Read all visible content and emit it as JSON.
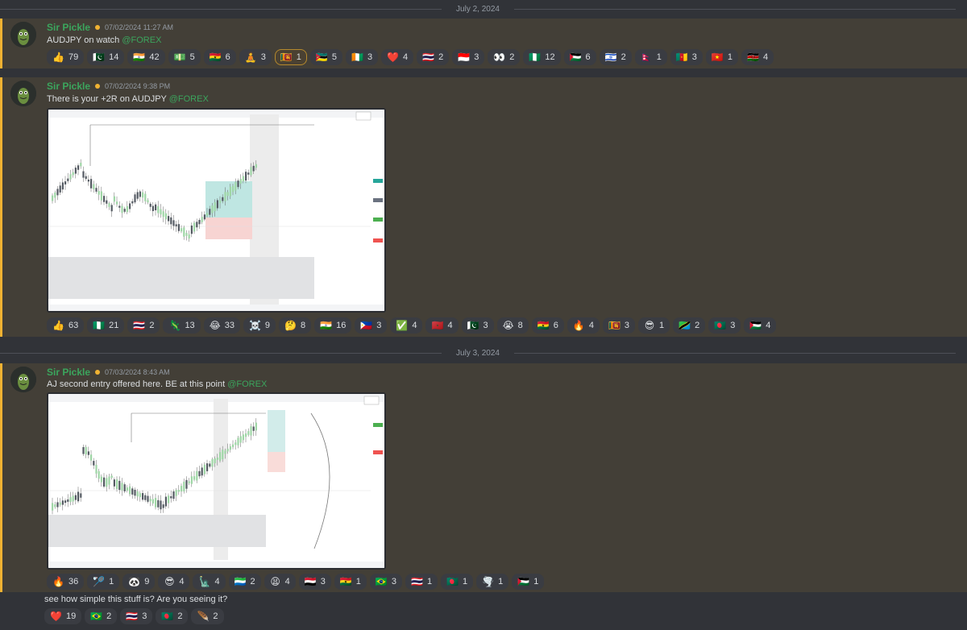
{
  "dividers": {
    "d1": "July 2, 2024",
    "d2": "July 3, 2024"
  },
  "messages": [
    {
      "author": "Sir Pickle",
      "timestamp": "07/02/2024 11:27 AM",
      "text": "AUDJPY on watch ",
      "mention": "@FOREX",
      "reactions": [
        {
          "emoji": "👍",
          "count": "79"
        },
        {
          "emoji": "🇵🇰",
          "count": "14"
        },
        {
          "emoji": "🇮🇳",
          "count": "42"
        },
        {
          "emoji": "💵",
          "count": "5"
        },
        {
          "emoji": "🇬🇭",
          "count": "6"
        },
        {
          "emoji": "🧘",
          "count": "3"
        },
        {
          "emoji": "🇱🇰",
          "count": "1",
          "active": true
        },
        {
          "emoji": "🇲🇿",
          "count": "5"
        },
        {
          "emoji": "🇨🇮",
          "count": "3"
        },
        {
          "emoji": "❤️",
          "count": "4"
        },
        {
          "emoji": "🇹🇭",
          "count": "2"
        },
        {
          "emoji": "🇮🇩",
          "count": "3"
        },
        {
          "emoji": "👀",
          "count": "2"
        },
        {
          "emoji": "🇳🇬",
          "count": "12"
        },
        {
          "emoji": "🇵🇸",
          "count": "6"
        },
        {
          "emoji": "🇮🇱",
          "count": "2"
        },
        {
          "emoji": "🇳🇵",
          "count": "1"
        },
        {
          "emoji": "🇨🇲",
          "count": "3"
        },
        {
          "emoji": "🇻🇳",
          "count": "1"
        },
        {
          "emoji": "🇰🇪",
          "count": "4"
        }
      ]
    },
    {
      "author": "Sir Pickle",
      "timestamp": "07/02/2024 9:38 PM",
      "text": "There is your +2R on AUDJPY ",
      "mention": "@FOREX",
      "reactions": [
        {
          "emoji": "👍",
          "count": "63"
        },
        {
          "emoji": "🇳🇬",
          "count": "21"
        },
        {
          "emoji": "🇹🇭",
          "count": "2"
        },
        {
          "emoji": "🦎",
          "count": "13"
        },
        {
          "emoji": "😂",
          "count": "33"
        },
        {
          "emoji": "☠️",
          "count": "9"
        },
        {
          "emoji": "🤔",
          "count": "8"
        },
        {
          "emoji": "🇮🇳",
          "count": "16"
        },
        {
          "emoji": "🇵🇭",
          "count": "3"
        },
        {
          "emoji": "✅",
          "count": "4"
        },
        {
          "emoji": "🇲🇦",
          "count": "4"
        },
        {
          "emoji": "🇵🇰",
          "count": "3"
        },
        {
          "emoji": "😭",
          "count": "8"
        },
        {
          "emoji": "🇬🇭",
          "count": "6"
        },
        {
          "emoji": "🔥",
          "count": "4"
        },
        {
          "emoji": "🇱🇰",
          "count": "3"
        },
        {
          "emoji": "😎",
          "count": "1"
        },
        {
          "emoji": "🇹🇿",
          "count": "2"
        },
        {
          "emoji": "🇧🇩",
          "count": "3"
        },
        {
          "emoji": "🇵🇸",
          "count": "4"
        }
      ]
    },
    {
      "author": "Sir Pickle",
      "timestamp": "07/03/2024 8:43 AM",
      "text": "AJ second entry offered here. BE at this point ",
      "mention": "@FOREX",
      "reactions": [
        {
          "emoji": "🔥",
          "count": "36"
        },
        {
          "emoji": "🏸",
          "count": "1"
        },
        {
          "emoji": "🐼",
          "count": "9"
        },
        {
          "emoji": "😎",
          "count": "4"
        },
        {
          "emoji": "🗽",
          "count": "4"
        },
        {
          "emoji": "🇸🇱",
          "count": "2"
        },
        {
          "emoji": "😫",
          "count": "4"
        },
        {
          "emoji": "🇾🇪",
          "count": "3"
        },
        {
          "emoji": "🇬🇭",
          "count": "1"
        },
        {
          "emoji": "🇧🇷",
          "count": "3"
        },
        {
          "emoji": "🇹🇭",
          "count": "1"
        },
        {
          "emoji": "🇧🇩",
          "count": "1"
        },
        {
          "emoji": "🌪️",
          "count": "1"
        },
        {
          "emoji": "🇵🇸",
          "count": "1"
        }
      ]
    },
    {
      "text": "see how simple this stuff is? Are you seeing it?",
      "reactions": [
        {
          "emoji": "❤️",
          "count": "19"
        },
        {
          "emoji": "🇧🇷",
          "count": "2"
        },
        {
          "emoji": "🇹🇭",
          "count": "3"
        },
        {
          "emoji": "🇧🇩",
          "count": "2"
        },
        {
          "emoji": "🪶",
          "count": "2"
        }
      ]
    }
  ],
  "colors": {
    "author": "#3ba55d",
    "highlight_bar": "#f0b232",
    "highlight_bg": "#433f37",
    "bull": "#9fd6a6",
    "bear": "#555b63"
  }
}
